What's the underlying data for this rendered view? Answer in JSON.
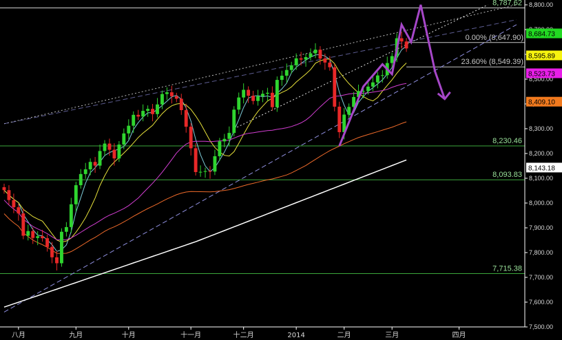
{
  "chart_data": {
    "type": "line",
    "title": "",
    "xlabel": "",
    "ylabel": "",
    "ylim": [
      7500,
      8810
    ],
    "grid": false,
    "y_ticks": [
      "8,800.00",
      "8,700.00",
      "8,600.00",
      "8,500.00",
      "8,400.00",
      "8,300.00",
      "8,200.00",
      "8,100.00",
      "8,000.00",
      "7,900.00",
      "7,800.00",
      "7,700.00",
      "7,600.00",
      "7,500.00"
    ],
    "y_tick_values": [
      8800,
      8700,
      8600,
      8500,
      8400,
      8300,
      8200,
      8100,
      8000,
      7900,
      7800,
      7700,
      7600,
      7500
    ],
    "x_labels": [
      "八月",
      "九月",
      "十月",
      "十一月",
      "十二月",
      "2014",
      "二月",
      "三月",
      "四月"
    ],
    "x_label_index": [
      3,
      15,
      26,
      39,
      50,
      61,
      71,
      81,
      95
    ],
    "x_range": [
      0,
      107
    ],
    "candles_close": [
      8052,
      8012,
      7983,
      7958,
      7868,
      7887,
      7859,
      7866,
      7858,
      7823,
      7781,
      7757,
      7884,
      7903,
      7995,
      8072,
      8117,
      8136,
      8166,
      8151,
      8210,
      8240,
      8215,
      8180,
      8236,
      8281,
      8312,
      8356,
      8349,
      8372,
      8380,
      8359,
      8398,
      8440,
      8447,
      8431,
      8421,
      8375,
      8308,
      8221,
      8125,
      8126,
      8129,
      8127,
      8189,
      8249,
      8259,
      8283,
      8377,
      8426,
      8457,
      8433,
      8412,
      8431,
      8441,
      8445,
      8387,
      8497,
      8514,
      8537,
      8556,
      8584,
      8579,
      8589,
      8604,
      8619,
      8583,
      8567,
      8548,
      8389,
      8286,
      8357,
      8388,
      8428,
      8452,
      8452,
      8470,
      8487,
      8515,
      8516,
      8565,
      8593,
      8665,
      8652,
      8624
    ],
    "levels": [
      {
        "label": "8,787.62",
        "value": 8787.62
      },
      {
        "label": "8,230.46",
        "value": 8230.46
      },
      {
        "label": "8,093.83",
        "value": 8093.83
      },
      {
        "label": "7,715.38",
        "value": 7715.38
      }
    ],
    "fib_levels": [
      {
        "label": "0.00% (8,647.90)",
        "value": 8647.9
      },
      {
        "label": "23.60% (8,549.39)",
        "value": 8549.39
      }
    ],
    "series": [
      {
        "color": "#7ecbd8",
        "current": "8,684.73",
        "current_value": 8684.73,
        "tag_bg": "#22d822",
        "tag_fg": "#000000"
      },
      {
        "color": "#e8e23a",
        "current": "8,595.89",
        "current_value": 8595.89,
        "tag_bg": "#f6f30f",
        "tag_fg": "#000000"
      },
      {
        "color": "#d23ed2",
        "current": "8,523.73",
        "current_value": 8523.73,
        "tag_bg": "#e81ee8",
        "tag_fg": "#000000"
      },
      {
        "color": "#ee6a2a",
        "current": "8,409.10",
        "current_value": 8409.1,
        "tag_bg": "#f27a1e",
        "tag_fg": "#000000"
      },
      {
        "color": "#ffffff",
        "current": "8,143.18",
        "current_value": 8143.18,
        "tag_bg": "#ffffff",
        "tag_fg": "#000000"
      }
    ],
    "colors": {
      "up": "#2fd52f",
      "down": "#e82828",
      "level_line": "#3ca83c",
      "fib_line": "#c8c8c8",
      "trend_line": "#8a8ad6",
      "annotation": "#a647c8",
      "axis": "#ffffff"
    }
  }
}
